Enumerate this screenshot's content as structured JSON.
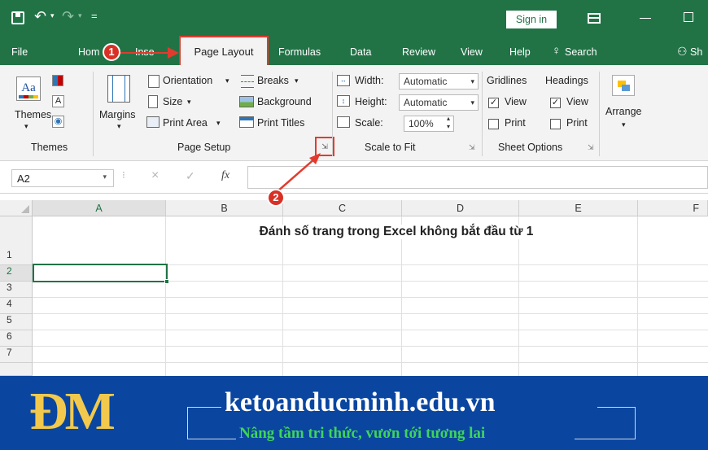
{
  "titlebar": {
    "quick_access_overflow": "=",
    "sign_in": "Sign in"
  },
  "tabs": [
    "File",
    "Hom",
    "Inse",
    "Page Layout",
    "Formulas",
    "Data",
    "Review",
    "View",
    "Help"
  ],
  "tell_me": "Search",
  "share": "Sh",
  "ribbon": {
    "themes": {
      "themes_label": "Themes",
      "group": "Themes"
    },
    "page_setup": {
      "margins": "Margins",
      "orientation": "Orientation",
      "size": "Size",
      "print_area": "Print Area",
      "breaks": "Breaks",
      "background": "Background",
      "print_titles": "Print Titles",
      "group": "Page Setup"
    },
    "scale_to_fit": {
      "width_label": "Width:",
      "width_value": "Automatic",
      "height_label": "Height:",
      "height_value": "Automatic",
      "scale_label": "Scale:",
      "scale_value": "100%",
      "group": "Scale to Fit"
    },
    "sheet_options": {
      "gridlines": "Gridlines",
      "headings": "Headings",
      "view": "View",
      "print": "Print",
      "group": "Sheet Options"
    },
    "arrange": "Arrange"
  },
  "formula_bar": {
    "name_box": "A2",
    "fx": "fx",
    "value": ""
  },
  "sheet": {
    "columns": [
      "A",
      "B",
      "C",
      "D",
      "E",
      "F"
    ],
    "rows": [
      "1",
      "2",
      "3",
      "4",
      "5",
      "6",
      "7"
    ],
    "title_cell": "Đánh số trang trong Excel không bắt đầu từ 1"
  },
  "annotations": {
    "badge1": "1",
    "badge2": "2"
  },
  "banner": {
    "logo": "ĐM",
    "site": "ketoanducminh.edu.vn",
    "slogan": "Nâng tầm tri thức, vươn tới tương lai"
  },
  "colors": {
    "excel_green": "#217346",
    "highlight_red": "#e23b2e",
    "banner_blue": "#0a46a0",
    "banner_gold": "#f2c94c"
  }
}
